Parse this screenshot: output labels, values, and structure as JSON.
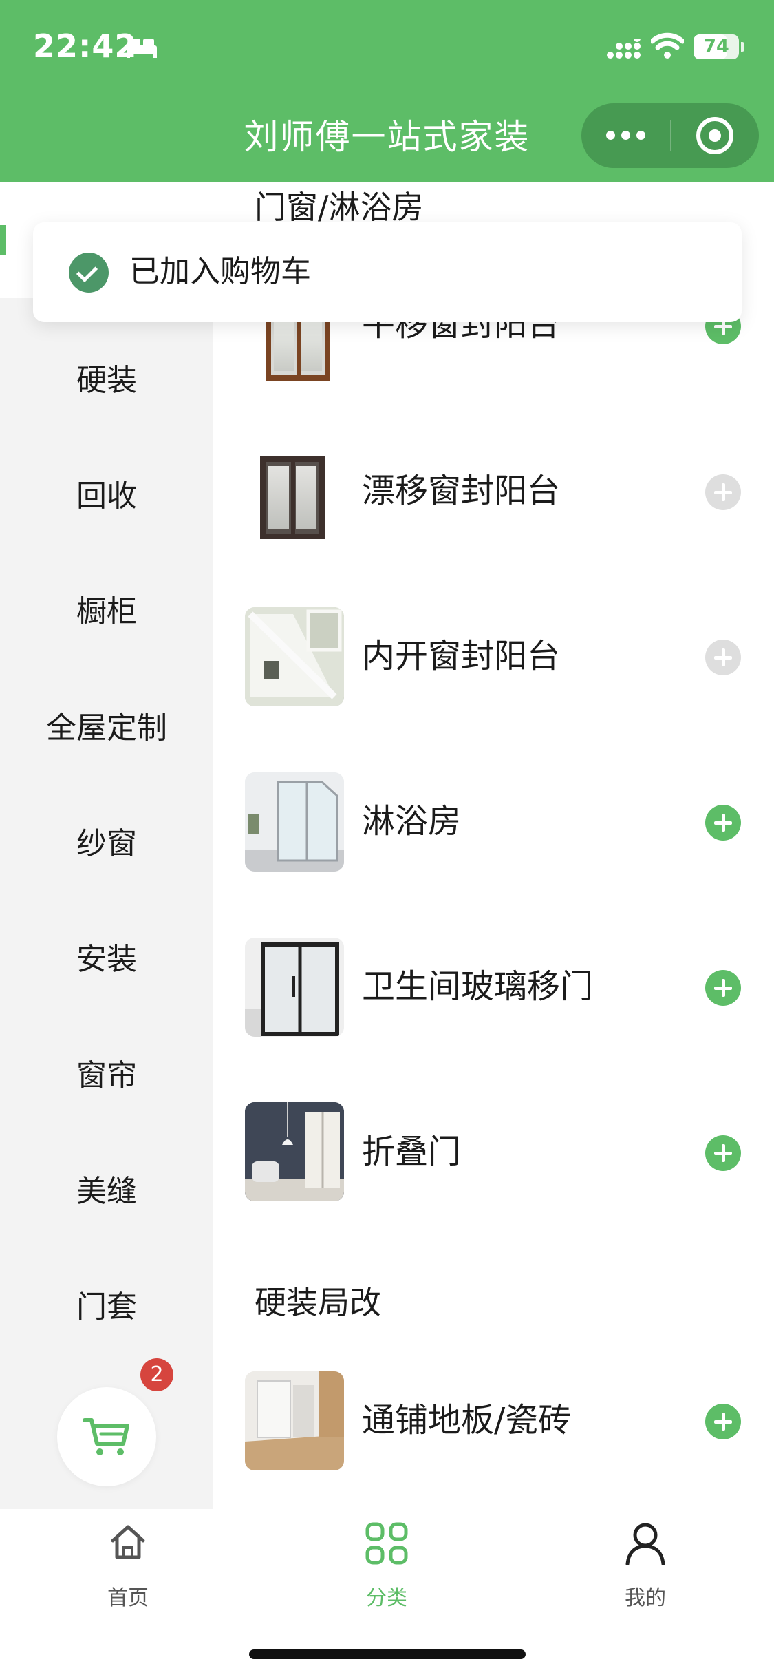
{
  "status_bar": {
    "time": "22:42",
    "battery": "74",
    "battery_level": 0.74
  },
  "app": {
    "title": "刘师傅一站式家装"
  },
  "capsule": {
    "more_icon": "more-dots-icon",
    "close_icon": "target-close-icon"
  },
  "toast": {
    "message": "已加入购物车",
    "icon": "check-circle-icon"
  },
  "sidebar": {
    "items": [
      {
        "label": "硬装"
      },
      {
        "label": "回收"
      },
      {
        "label": "橱柜"
      },
      {
        "label": "全屋定制"
      },
      {
        "label": "纱窗"
      },
      {
        "label": "安装"
      },
      {
        "label": "窗帘"
      },
      {
        "label": "美缝"
      },
      {
        "label": "门套"
      }
    ],
    "cart_badge": "2"
  },
  "main": {
    "sections": [
      {
        "title": "门窗/淋浴房",
        "products": [
          {
            "name": "平移窗封阳台",
            "can_add": true
          },
          {
            "name": "漂移窗封阳台",
            "can_add": false
          },
          {
            "name": "内开窗封阳台",
            "can_add": false
          },
          {
            "name": "淋浴房",
            "can_add": true
          },
          {
            "name": "卫生间玻璃移门",
            "can_add": true
          },
          {
            "name": "折叠门",
            "can_add": true
          }
        ]
      },
      {
        "title": "硬装局改",
        "products": [
          {
            "name": "通铺地板/瓷砖",
            "can_add": true
          }
        ]
      }
    ]
  },
  "tabbar": {
    "tabs": [
      {
        "label": "首页",
        "icon": "home-icon"
      },
      {
        "label": "分类",
        "icon": "category-grid-icon",
        "active": true
      },
      {
        "label": "我的",
        "icon": "user-icon"
      }
    ]
  },
  "colors": {
    "brand_green": "#5dbd67",
    "capsule_green": "#479a52",
    "badge_red": "#d6453e",
    "disabled_gray": "#dedede"
  }
}
